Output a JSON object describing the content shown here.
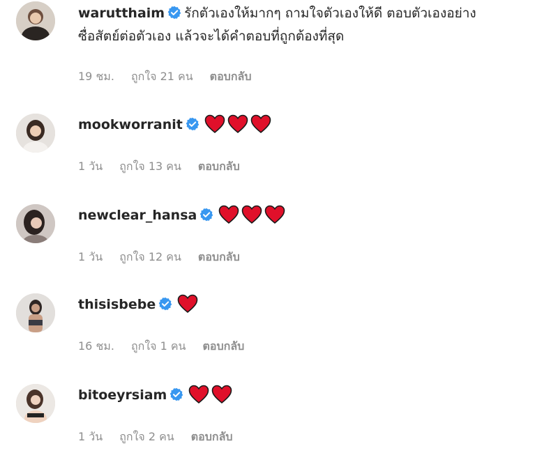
{
  "comments": [
    {
      "username": "warutthaim",
      "text_line1": "รักตัวเองให้มากๆ ถามใจตัวเองให้ดี ตอบตัวเองอย่าง",
      "text_line2": "ซื่อสัตย์ต่อตัวเอง แล้วจะได้คำตอบที่ถูกต้องที่สุด",
      "hearts": 0,
      "time": "19 ชม.",
      "likes": "ถูกใจ 21 คน",
      "reply": "ตอบกลับ"
    },
    {
      "username": "mookworranit",
      "text_line1": "",
      "hearts": 3,
      "time": "1 วัน",
      "likes": "ถูกใจ 13 คน",
      "reply": "ตอบกลับ"
    },
    {
      "username": "newclear_hansa",
      "text_line1": "",
      "hearts": 3,
      "time": "1 วัน",
      "likes": "ถูกใจ 12 คน",
      "reply": "ตอบกลับ"
    },
    {
      "username": "thisisbebe",
      "text_line1": "",
      "hearts": 1,
      "time": "16 ชม.",
      "likes": "ถูกใจ 1 คน",
      "reply": "ตอบกลับ"
    },
    {
      "username": "bitoeyrsiam",
      "text_line1": "",
      "hearts": 2,
      "time": "1 วัน",
      "likes": "ถูกใจ 2 คน",
      "reply": "ตอบกลับ"
    }
  ],
  "icons": {
    "verified": "verified-badge-icon",
    "heart": "red-heart-icon"
  },
  "colors": {
    "verified": "#3897f0",
    "heart": "#e0102a",
    "meta": "#8e8e8e",
    "text": "#262626"
  }
}
